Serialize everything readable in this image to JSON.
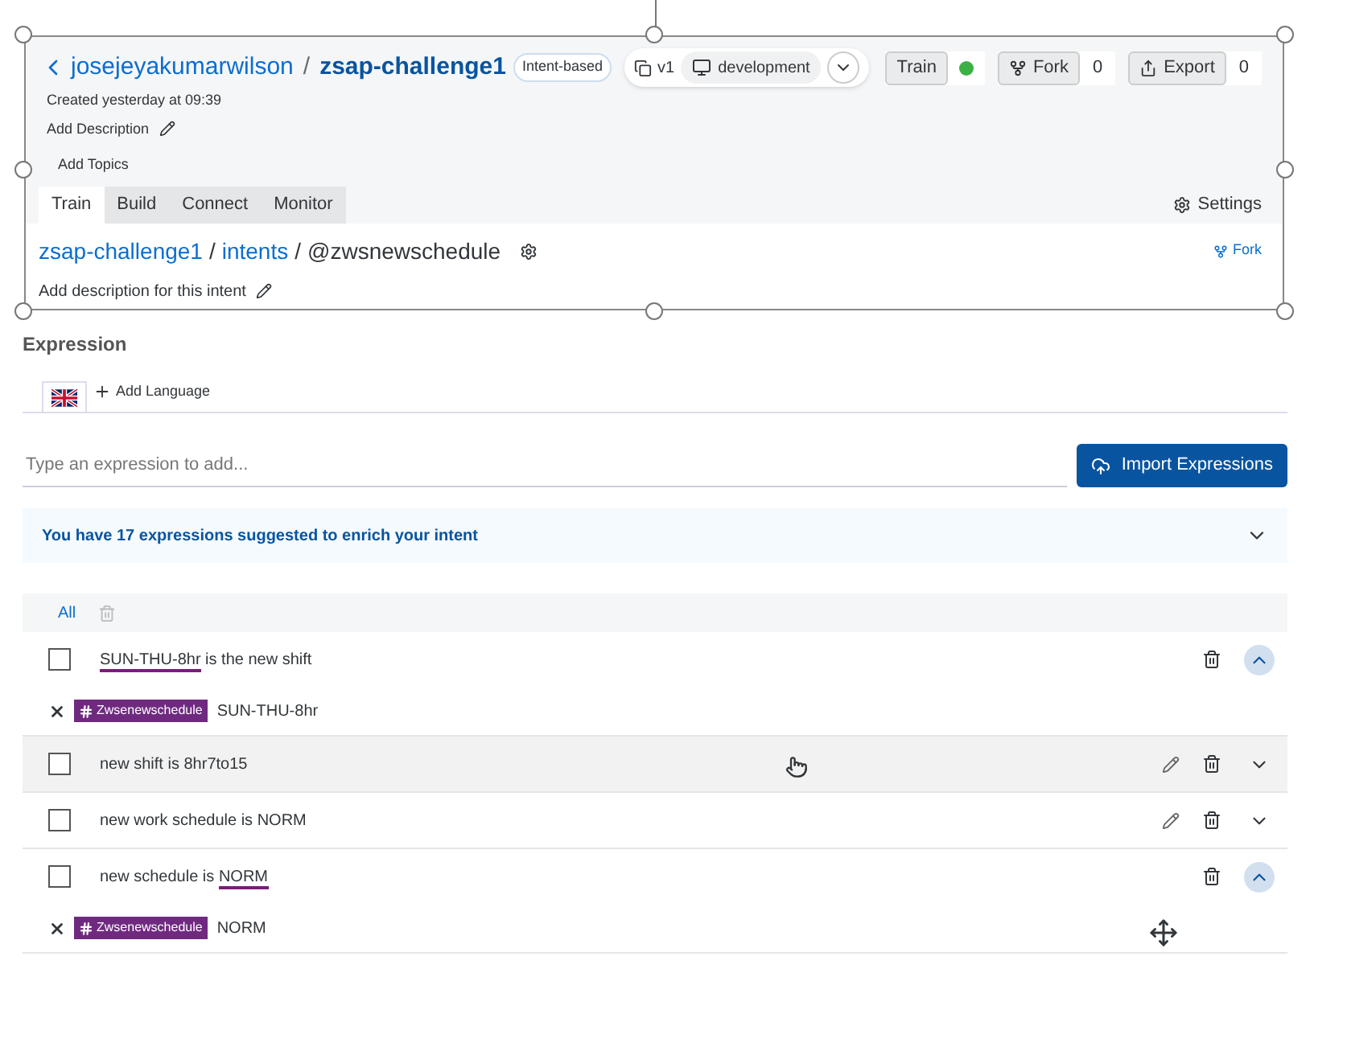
{
  "header": {
    "owner": "josejeyakumarwilson",
    "separator": "/",
    "project": "zsap-challenge1",
    "project_type": "Intent-based",
    "version": "v1",
    "environment": "development",
    "created": "Created yesterday at 09:39",
    "add_description": "Add Description",
    "add_topics": "Add Topics"
  },
  "actions": [
    {
      "label": "Train",
      "kind": "status",
      "color": "#3bb143"
    },
    {
      "label": "Fork",
      "kind": "count",
      "count": "0"
    },
    {
      "label": "Export",
      "kind": "count",
      "count": "0"
    }
  ],
  "tabs": [
    {
      "label": "Train",
      "selected": true
    },
    {
      "label": "Build",
      "selected": false
    },
    {
      "label": "Connect",
      "selected": false
    },
    {
      "label": "Monitor",
      "selected": false
    }
  ],
  "settings": "Settings",
  "breadcrumb": {
    "project": "zsap-challenge1",
    "intents": "intents",
    "separator": "/",
    "intent": "@zwsnewschedule",
    "fork": "Fork",
    "description": "Add description for this intent"
  },
  "expression": {
    "title": "Expression",
    "add_language": "Add Language",
    "placeholder": "Type an expression to add...",
    "import": "Import Expressions",
    "suggestion": "You have 17 expressions suggested to enrich your intent",
    "filter": "All"
  },
  "rows": [
    {
      "checked": false,
      "hovered": false,
      "editable": false,
      "expanded": true,
      "parts": [
        {
          "text": "SUN-THU-8hr",
          "entity": true
        },
        {
          "text": " is the new shift",
          "entity": false
        }
      ],
      "annotations": [
        {
          "tag": "Zwsenewschedule",
          "value": "SUN-THU-8hr"
        }
      ]
    },
    {
      "checked": false,
      "hovered": true,
      "editable": true,
      "expanded": false,
      "parts": [
        {
          "text": "new shift is 8hr7to15",
          "entity": false
        }
      ]
    },
    {
      "checked": false,
      "hovered": false,
      "editable": true,
      "expanded": false,
      "parts": [
        {
          "text": "new work schedule is NORM",
          "entity": false
        }
      ]
    },
    {
      "checked": false,
      "hovered": false,
      "editable": false,
      "expanded": true,
      "parts": [
        {
          "text": "new schedule is ",
          "entity": false
        },
        {
          "text": "NORM",
          "entity": true
        }
      ],
      "annotations": [
        {
          "tag": "Zwsenewschedule",
          "value": "NORM"
        }
      ]
    }
  ]
}
